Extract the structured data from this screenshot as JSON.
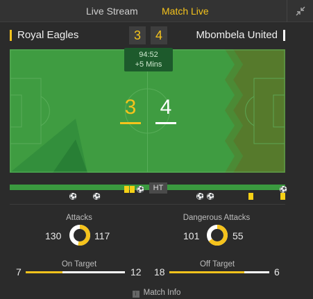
{
  "tabs": [
    {
      "label": "Live Stream"
    },
    {
      "label": "Match Live"
    }
  ],
  "match": {
    "home_team": "Royal Eagles",
    "away_team": "Mbombela United",
    "home_score": "3",
    "away_score": "4",
    "clock": "94:52",
    "added_time": "+5 Mins"
  },
  "timeline": {
    "halftime_label": "HT",
    "progress": 1.0
  },
  "stats": {
    "attacks": {
      "title": "Attacks",
      "home": "130",
      "away": "117",
      "home_share": 0.526
    },
    "dangerous_attacks": {
      "title": "Dangerous Attacks",
      "home": "101",
      "away": "55",
      "home_share": 0.647
    },
    "on_target": {
      "title": "On Target",
      "home": "7",
      "away": "12",
      "home_share": 0.368
    },
    "off_target": {
      "title": "Off Target",
      "home": "18",
      "away": "6",
      "home_share": 0.75
    }
  },
  "footer": {
    "label": "Match Info"
  },
  "colors": {
    "accent": "#f5c31c",
    "pitch": "#3f9c41",
    "away": "#ffffff"
  }
}
